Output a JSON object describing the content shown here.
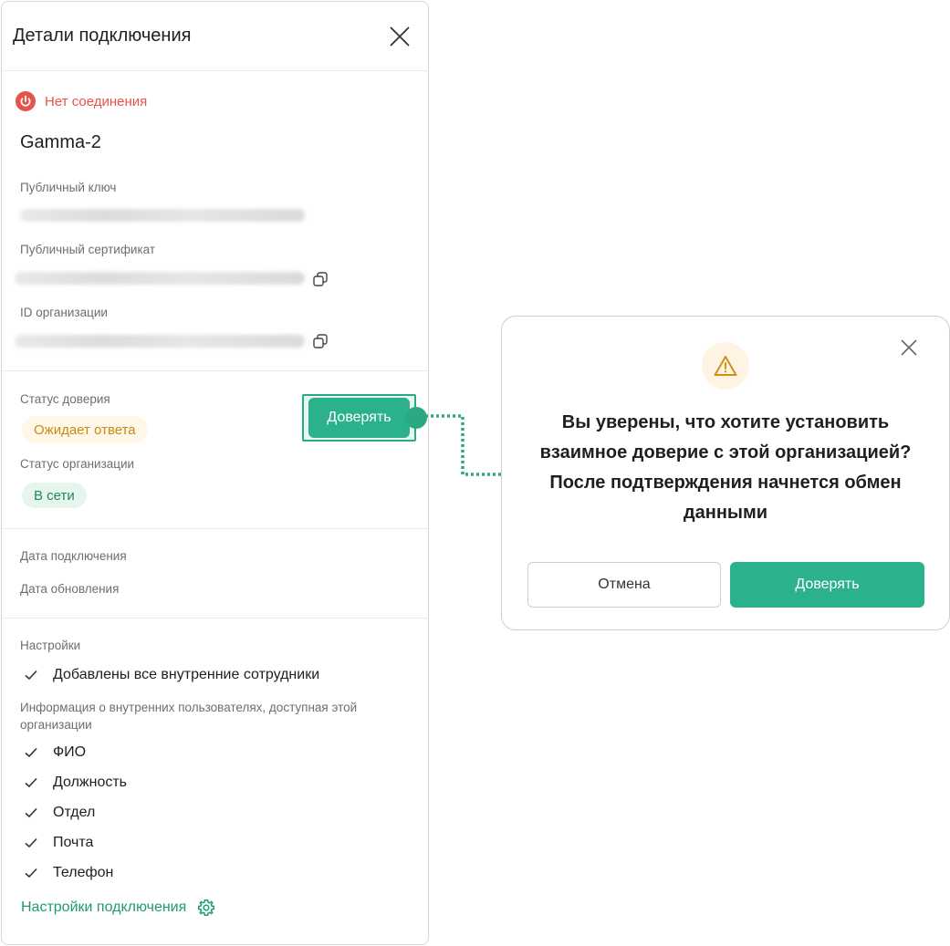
{
  "panel": {
    "title": "Детали подключения",
    "connection_status": "Нет соединения",
    "connection_name": "Gamma-2",
    "public_key_label": "Публичный ключ",
    "public_cert_label": "Публичный сертификат",
    "org_id_label": "ID организации",
    "trust_status_label": "Статус доверия",
    "trust_status_value": "Ожидает ответа",
    "trust_button_label": "Доверять",
    "org_status_label": "Статус организации",
    "org_status_value": "В сети",
    "connected_date_label": "Дата подключения",
    "updated_date_label": "Дата обновления",
    "settings_label": "Настройки",
    "settings_items": [
      "Добавлены все внутренние сотрудники"
    ],
    "info_label": "Информация о внутренних пользователях, доступная этой организации",
    "info_items": [
      "ФИО",
      "Должность",
      "Отдел",
      "Почта",
      "Телефон"
    ],
    "settings_link_label": "Настройки подключения"
  },
  "dialog": {
    "message": "Вы уверены, что хотите установить взаимное доверие с этой организацией? После подтверждения начнется обмен данными",
    "cancel_label": "Отмена",
    "confirm_label": "Доверять"
  },
  "colors": {
    "accent": "#2bb28c",
    "error": "#e5534b",
    "pending": "#c88a16",
    "online": "#1f8b5a"
  },
  "icons": {
    "close": "close-icon",
    "power": "power-icon",
    "copy": "copy-icon",
    "check": "check-icon",
    "gear": "gear-icon",
    "warning": "warning-icon"
  }
}
